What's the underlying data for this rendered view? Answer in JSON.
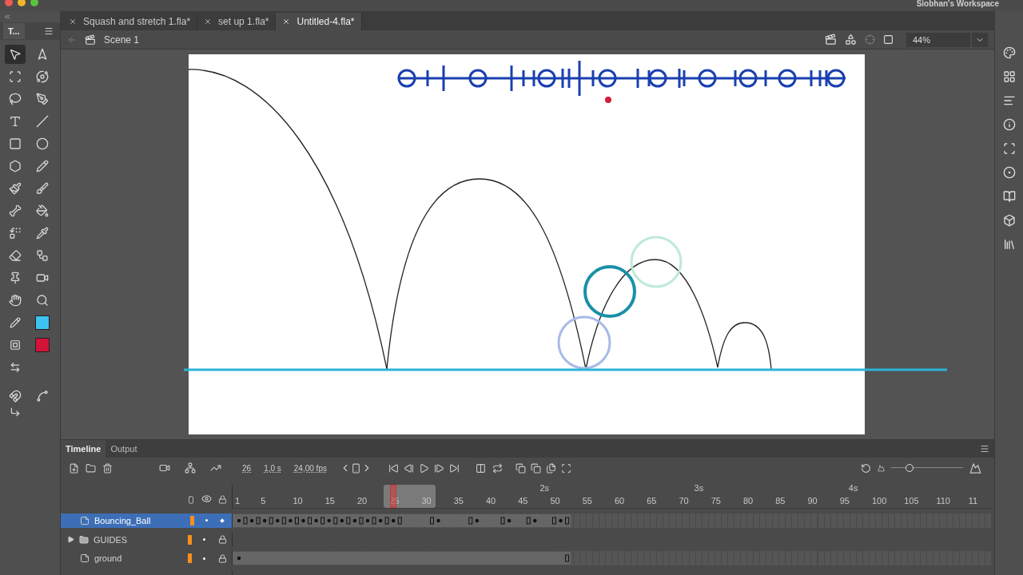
{
  "title_bar": {
    "workspace": "Siobhan's Workspace"
  },
  "tools_panel": {
    "title": "T...",
    "tools": [
      {
        "kind": "select",
        "selected": true
      },
      {
        "kind": "subselect",
        "selected": false
      },
      {
        "kind": "transform",
        "selected": false
      },
      {
        "kind": "rotate3d",
        "selected": false
      },
      {
        "kind": "lasso",
        "selected": false
      },
      {
        "kind": "pen",
        "selected": false
      },
      {
        "kind": "text",
        "selected": false
      },
      {
        "kind": "line",
        "selected": false
      },
      {
        "kind": "rect",
        "selected": false
      },
      {
        "kind": "oval",
        "selected": false
      },
      {
        "kind": "polygon",
        "selected": false
      },
      {
        "kind": "pencil",
        "selected": false
      },
      {
        "kind": "paintbrush",
        "selected": false
      },
      {
        "kind": "brush",
        "selected": false
      },
      {
        "kind": "bone",
        "selected": false
      },
      {
        "kind": "bucket",
        "selected": false
      },
      {
        "kind": "replace",
        "selected": false
      },
      {
        "kind": "eyedropper",
        "selected": false
      },
      {
        "kind": "eraser",
        "selected": false
      },
      {
        "kind": "puppet",
        "selected": false
      },
      {
        "kind": "pin",
        "selected": false
      },
      {
        "kind": "camera",
        "selected": false
      },
      {
        "kind": "hand",
        "selected": false
      },
      {
        "kind": "zoom",
        "selected": false
      }
    ],
    "swatches": [
      {
        "kind": "stroke",
        "color": "#3ec4f0"
      },
      {
        "kind": "fill",
        "color": "#d2133a"
      }
    ]
  },
  "document_tabs": [
    {
      "label": "Squash and stretch 1.fla*",
      "selected": false
    },
    {
      "label": "set up 1.fla*",
      "selected": false
    },
    {
      "label": "Untitled-4.fla*",
      "selected": true
    }
  ],
  "scene_bar": {
    "scene": "Scene 1",
    "zoom": "44%"
  },
  "timeline_panel": {
    "tabs": [
      {
        "label": "Timeline",
        "selected": true
      },
      {
        "label": "Output",
        "selected": false
      }
    ],
    "current_frame": "26",
    "elapsed": "1,0 s",
    "frame_rate": "24,00 fps",
    "zoom_slider": {
      "level": 0.25
    },
    "time_marks": [
      "2s",
      "3s",
      "4s"
    ],
    "frame_numbers": [
      "1",
      "5",
      "10",
      "15",
      "20",
      "25",
      "30",
      "35",
      "40",
      "45",
      "50",
      "55",
      "60",
      "65",
      "70",
      "75",
      "80",
      "85",
      "90",
      "95",
      "100",
      "105",
      "110",
      "11"
    ],
    "layers": [
      {
        "name": "Bouncing_Ball",
        "kind": "layer",
        "selected": true,
        "locked": false,
        "color": "#f7901e"
      },
      {
        "name": "GUIDES",
        "kind": "folder",
        "selected": false,
        "expanded": false,
        "locked": true,
        "color": "#f7901e"
      },
      {
        "name": "ground",
        "kind": "layer",
        "selected": false,
        "locked": true,
        "color": "#f7901e"
      }
    ]
  }
}
